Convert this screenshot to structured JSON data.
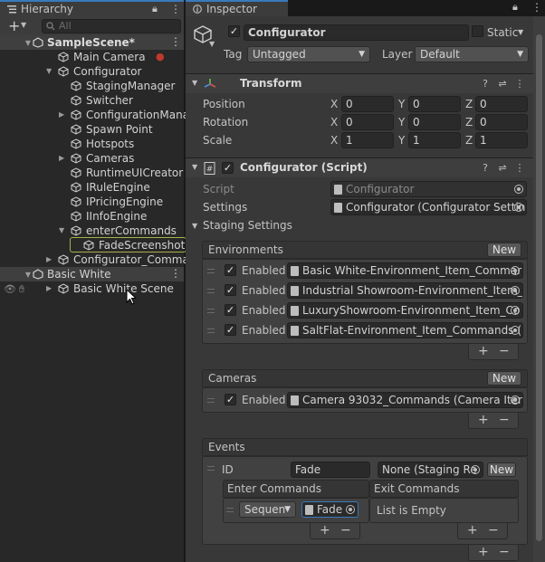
{
  "hierarchy": {
    "tab_label": "Hierarchy",
    "search_placeholder": "All",
    "scene1": "SampleScene*",
    "items": [
      {
        "label": "Main Camera"
      },
      {
        "label": "Configurator"
      },
      {
        "label": "StagingManager"
      },
      {
        "label": "Switcher"
      },
      {
        "label": "ConfigurationMana"
      },
      {
        "label": "Spawn Point"
      },
      {
        "label": "Hotspots"
      },
      {
        "label": "Cameras"
      },
      {
        "label": "RuntimeUICreator"
      },
      {
        "label": "IRuleEngine"
      },
      {
        "label": "IPricingEngine"
      },
      {
        "label": "IInfoEngine"
      },
      {
        "label": "enterCommands"
      },
      {
        "label": "FadeScreenshot"
      },
      {
        "label": "Configurator_Commar"
      }
    ],
    "scene2": "Basic White",
    "scene2_child": "Basic White Scene"
  },
  "inspector": {
    "tab_label": "Inspector",
    "object_name": "Configurator",
    "static_label": "Static",
    "tag_label": "Tag",
    "tag_value": "Untagged",
    "layer_label": "Layer",
    "layer_value": "Default",
    "transform": {
      "title": "Transform",
      "rows": [
        {
          "label": "Position",
          "x": "0",
          "y": "0",
          "z": "0"
        },
        {
          "label": "Rotation",
          "x": "0",
          "y": "0",
          "z": "0"
        },
        {
          "label": "Scale",
          "x": "1",
          "y": "1",
          "z": "1"
        }
      ],
      "axis_x": "X",
      "axis_y": "Y",
      "axis_z": "Z"
    },
    "script_component": {
      "title": "Configurator (Script)",
      "script_label": "Script",
      "script_value": "Configurator",
      "settings_label": "Settings",
      "settings_value": "Configurator (Configurator Settin",
      "staging_label": "Staging Settings"
    },
    "environments": {
      "title": "Environments",
      "new_label": "New",
      "enabled_label": "Enabled",
      "items": [
        "Basic White-Environment_Item_Commar",
        "Industrial Showroom-Environment_Item_",
        "LuxuryShowroom-Environment_Item_Co",
        "SaltFlat-Environment_Item_Commands ("
      ]
    },
    "cameras": {
      "title": "Cameras",
      "new_label": "New",
      "enabled_label": "Enabled",
      "items": [
        "Camera 93032_Commands (Camera Iter"
      ]
    },
    "events": {
      "title": "Events",
      "id_label": "ID",
      "id_value": "Fade",
      "staging_value": "None (Staging Re",
      "new_label": "New",
      "enter_title": "Enter Commands",
      "exit_title": "Exit Commands",
      "enter_type": "Sequen",
      "enter_value": "Fade",
      "exit_empty": "List is Empty"
    },
    "plus": "+",
    "minus": "−"
  }
}
